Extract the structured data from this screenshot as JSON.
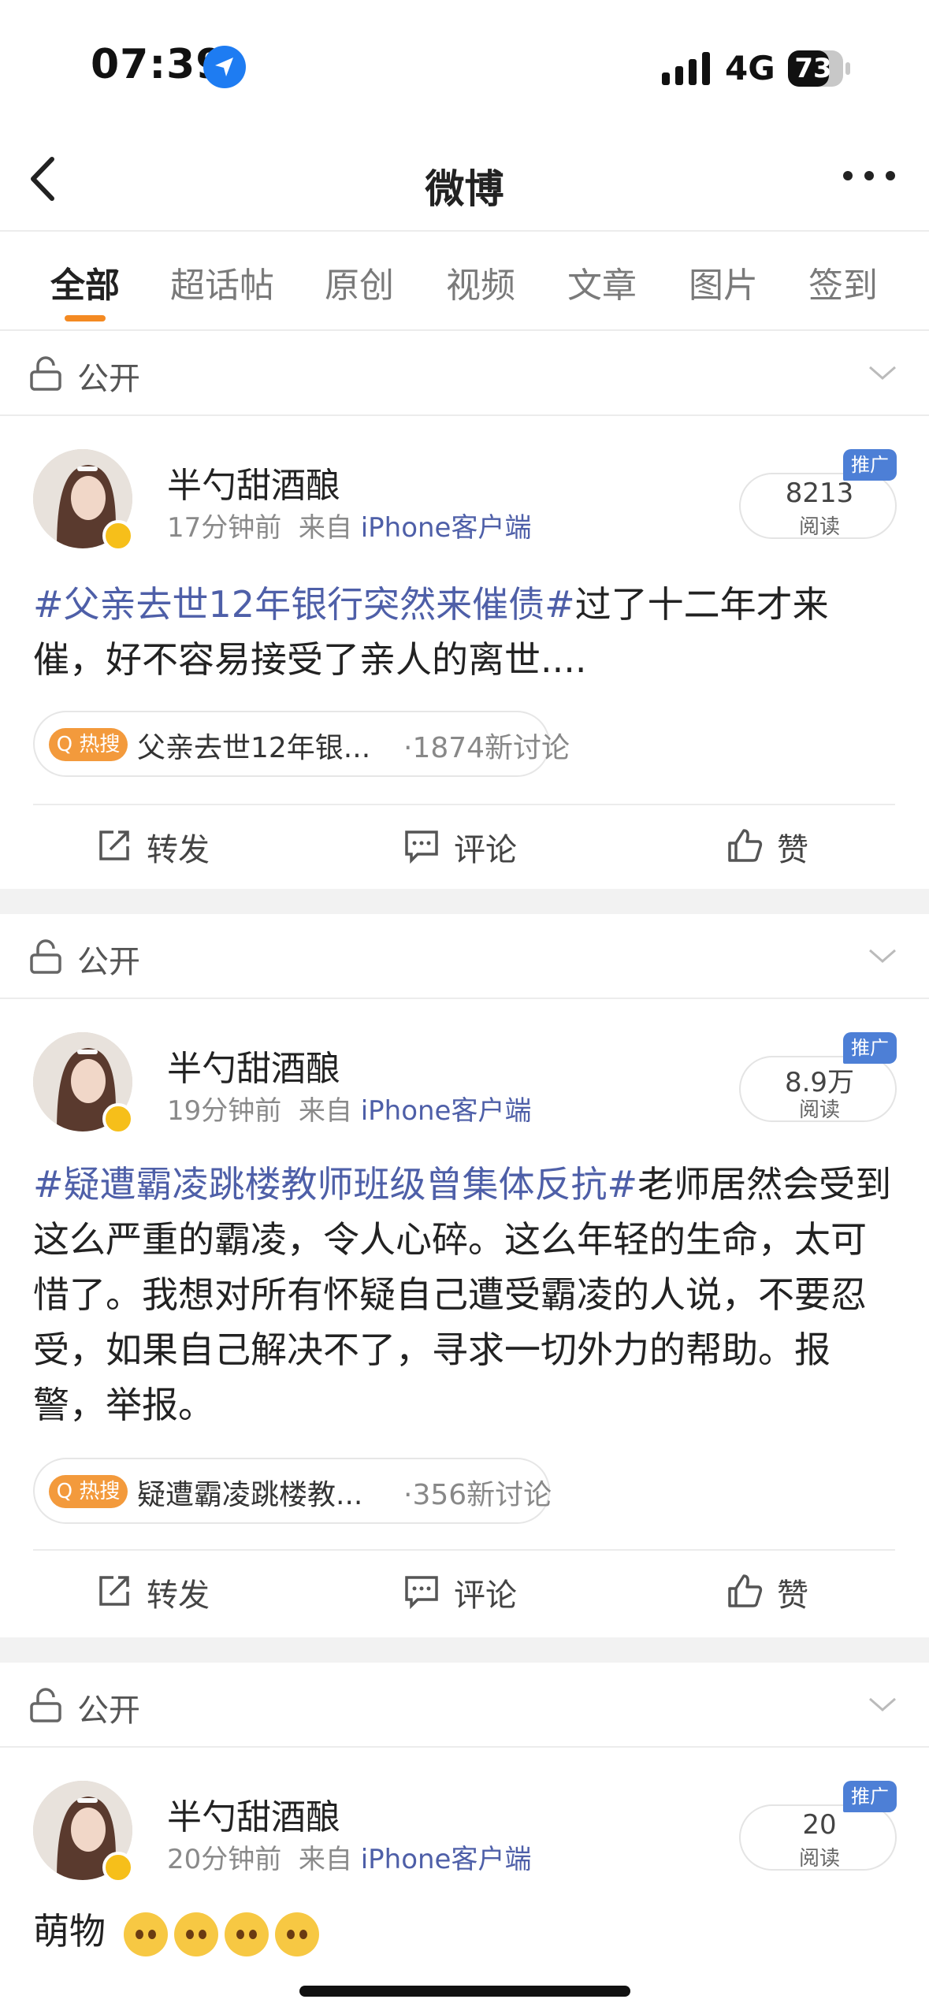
{
  "status_bar": {
    "time": "07:39",
    "network": "4G",
    "battery": "73"
  },
  "nav": {
    "title": "微博"
  },
  "tabs": [
    {
      "label": "全部",
      "active": true
    },
    {
      "label": "超话帖"
    },
    {
      "label": "原创"
    },
    {
      "label": "视频"
    },
    {
      "label": "文章"
    },
    {
      "label": "图片"
    },
    {
      "label": "签到"
    }
  ],
  "posts": [
    {
      "visibility": "公开",
      "author": "半勺甜酒酿",
      "time": "17分钟前",
      "source_prefix": "来自",
      "source": "iPhone客户端",
      "reads": "8213",
      "reads_label": "阅读",
      "promo": "推广",
      "topic": "#父亲去世12年银行突然来催债#",
      "text": "过了十二年才来催，好不容易接受了亲人的离世....",
      "hot_badge": "热搜",
      "hot_title": "父亲去世12年银...",
      "hot_count": "·1874新讨论",
      "actions": {
        "repost": "转发",
        "comment": "评论",
        "like": "赞"
      }
    },
    {
      "visibility": "公开",
      "author": "半勺甜酒酿",
      "time": "19分钟前",
      "source_prefix": "来自",
      "source": "iPhone客户端",
      "reads": "8.9万",
      "reads_label": "阅读",
      "promo": "推广",
      "topic": "#疑遭霸凌跳楼教师班级曾集体反抗#",
      "text": "老师居然会受到这么严重的霸凌，令人心碎。这么年轻的生命，太可惜了。我想对所有怀疑自己遭受霸凌的人说，不要忍受，如果自己解决不了，寻求一切外力的帮助。报警，举报。",
      "hot_badge": "热搜",
      "hot_title": "疑遭霸凌跳楼教...",
      "hot_count": "·356新讨论",
      "actions": {
        "repost": "转发",
        "comment": "评论",
        "like": "赞"
      }
    },
    {
      "visibility": "公开",
      "author": "半勺甜酒酿",
      "time": "20分钟前",
      "source_prefix": "来自",
      "source": "iPhone客户端",
      "reads": "20",
      "reads_label": "阅读",
      "promo": "推广",
      "text": "萌物"
    }
  ],
  "colors": {
    "accent": "#f48a22",
    "link": "#4e5fa8",
    "promo": "#4d7fd6",
    "hot": "#f39a3c"
  },
  "icons": [
    "location-arrow-icon",
    "signal-icon",
    "battery-icon",
    "back-icon",
    "more-icon",
    "lock-icon",
    "chevron-down-icon",
    "verified-icon",
    "repost-icon",
    "comment-icon",
    "like-icon",
    "emoji-icon"
  ]
}
